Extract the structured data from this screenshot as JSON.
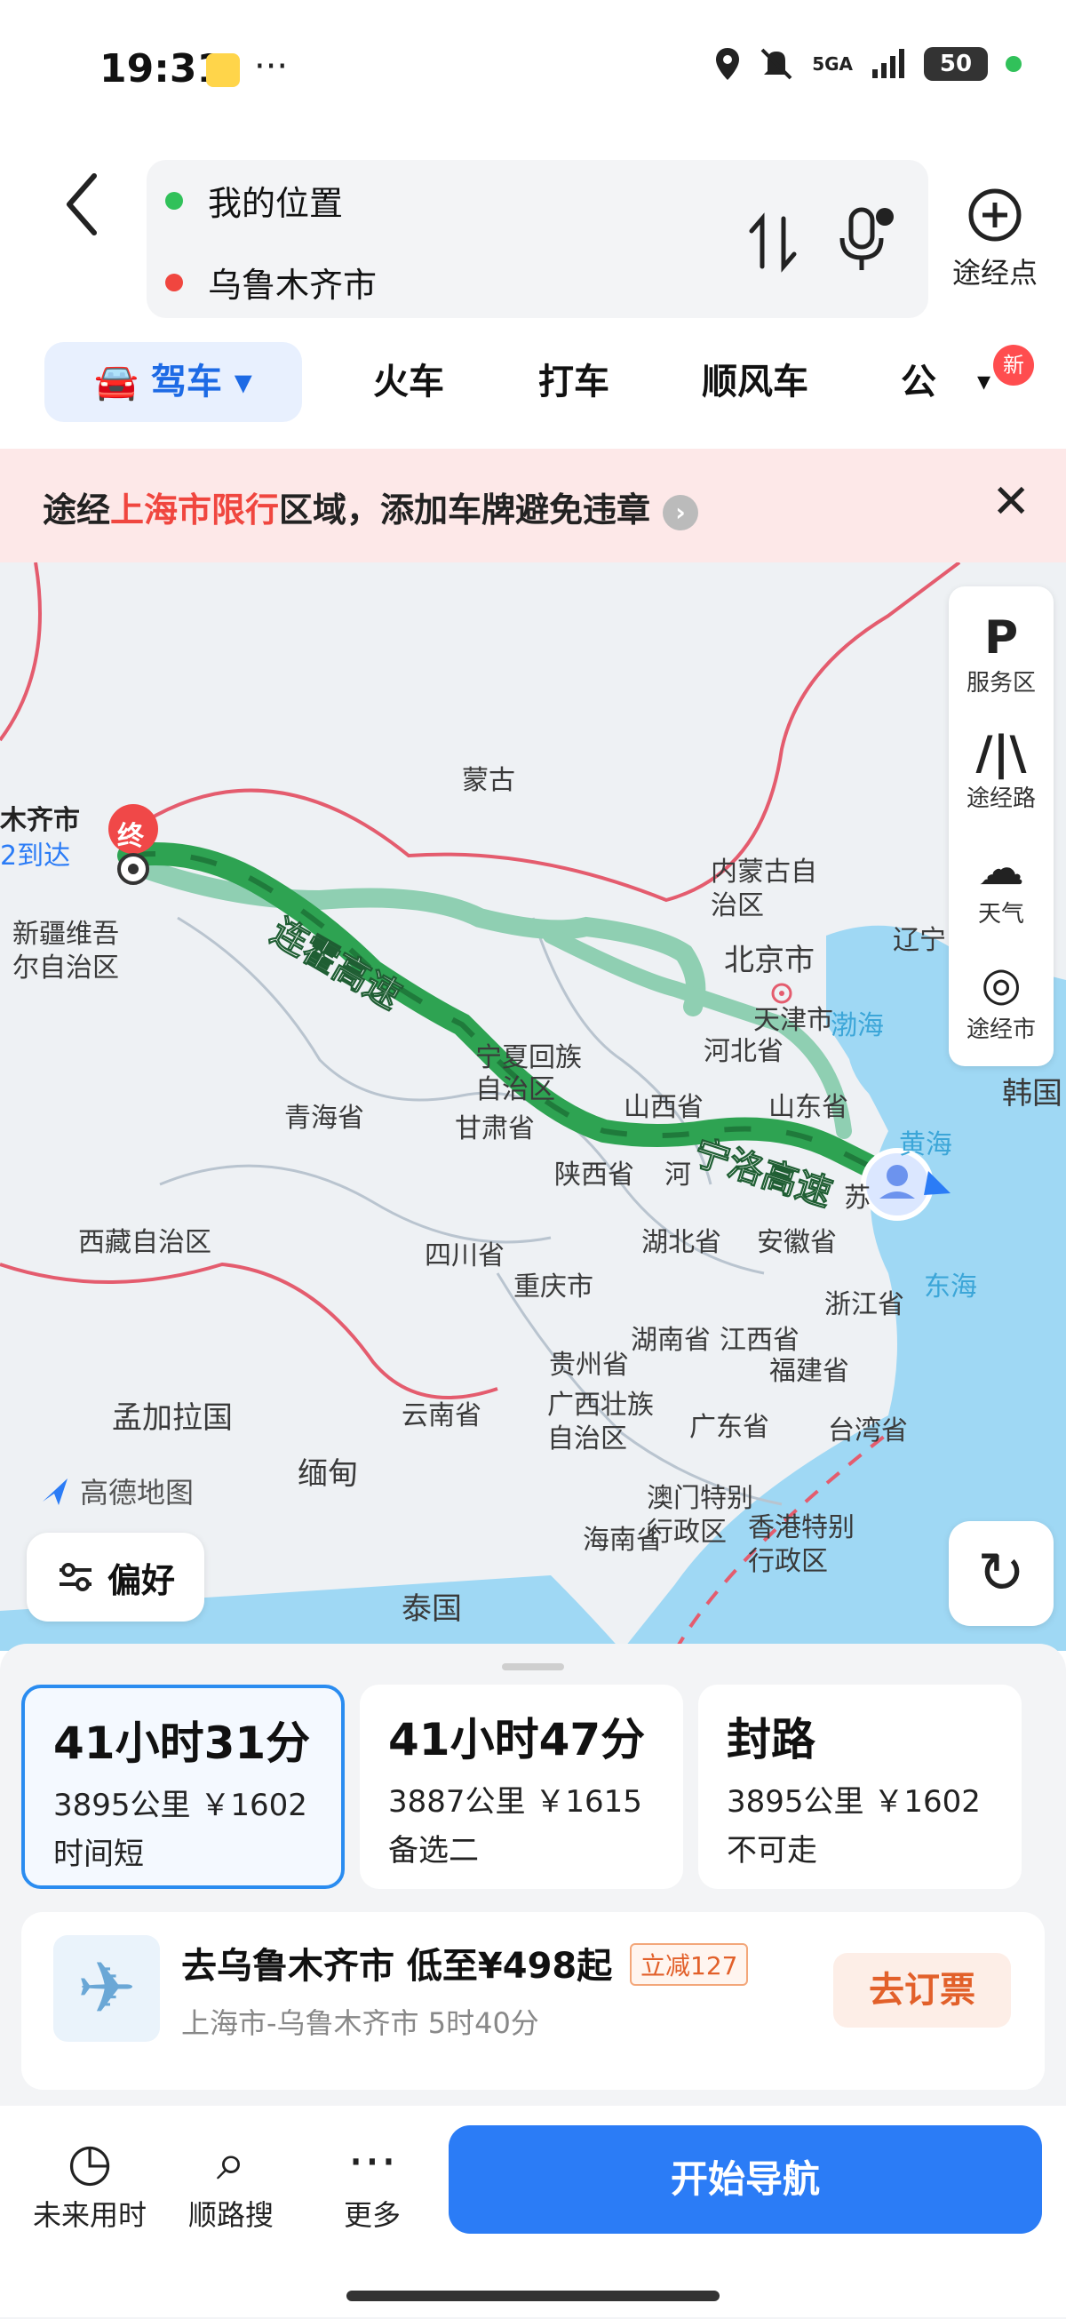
{
  "status_bar": {
    "time": "19:31",
    "more": "···",
    "network": "5GA",
    "battery": "50"
  },
  "header": {
    "origin": "我的位置",
    "destination": "乌鲁木齐市",
    "waypoint_label": "途经点",
    "origin_color": "#31c15a",
    "destination_color": "#f0463f"
  },
  "tabs": {
    "drive": "驾车",
    "train": "火车",
    "taxi": "打车",
    "carpool": "顺风车",
    "bus": "公",
    "new_badge": "新"
  },
  "warning": {
    "prefix": "途经",
    "highlight": "上海市限行",
    "suffix": "区域，添加车牌避免违章",
    "close": "✕"
  },
  "map": {
    "labels": {
      "mongolia": "蒙古",
      "urumqi": "木齐市",
      "arrive": "2到达",
      "end_marker": "终",
      "xinjiang": "新疆维吾\n尔自治区",
      "inner_mongolia": "内蒙古自\n治区",
      "beijing": "北京市",
      "liaoning": "辽宁",
      "tianjin": "天津市",
      "bohai": "渤海",
      "hebei": "河北省",
      "korea": "韩国",
      "qinghai": "青海省",
      "ningxia": "宁夏回族\n自治区",
      "gansu": "甘肃省",
      "shanxi": "山西省",
      "shandong": "山东省",
      "yellow_sea": "黄海",
      "shaanxi": "陕西省",
      "henan": "河",
      "jiangsu": "苏",
      "tibet": "西藏自治区",
      "sichuan": "四川省",
      "hubei": "湖北省",
      "anhui": "安徽省",
      "east_sea": "东海",
      "chongqing": "重庆市",
      "zhejiang": "浙江省",
      "hunan": "湖南省",
      "jiangxi": "江西省",
      "fujian": "福建省",
      "guizhou": "贵州省",
      "bangladesh": "孟加拉国",
      "yunnan": "云南省",
      "guangxi": "广西壮族\n自治区",
      "guangdong": "广东省",
      "taiwan": "台湾省",
      "myanmar": "缅甸",
      "macau": "澳门特别\n行政区",
      "hongkong": "香港特别\n行政区",
      "hainan": "海南省",
      "thailand": "泰国",
      "highway1": "连霍高速",
      "highway2": "宁洛高速"
    },
    "logo": "高德地图",
    "tools": [
      "服务区",
      "途经路",
      "天气",
      "途经市"
    ],
    "preference": "偏好"
  },
  "routes": [
    {
      "duration": "41小时31分",
      "meta": "3895公里 ￥1602",
      "tag": "时间短"
    },
    {
      "duration": "41小时47分",
      "meta": "3887公里 ￥1615",
      "tag": "备选二"
    },
    {
      "duration": "封路",
      "meta": "3895公里 ￥1602",
      "tag": "不可走"
    }
  ],
  "flight": {
    "title": "去乌鲁木齐市 低至¥498起",
    "coupon": "立减127",
    "subtitle": "上海市-乌鲁木齐市 5时40分",
    "book": "去订票"
  },
  "bottom_bar": {
    "future_time": "未来用时",
    "along_search": "顺路搜",
    "more": "更多",
    "more_icon": "···",
    "start_nav": "开始导航"
  }
}
